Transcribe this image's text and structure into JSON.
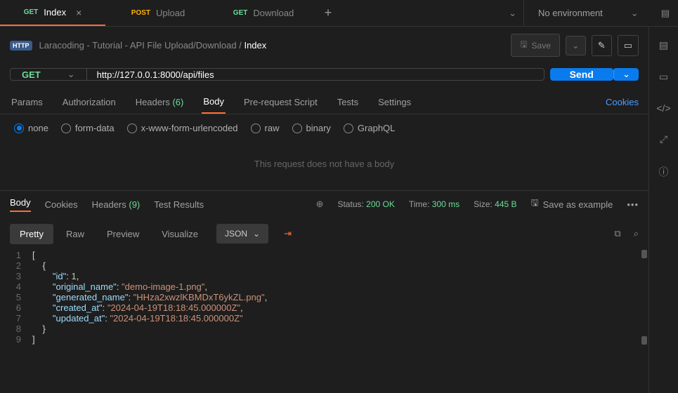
{
  "tabs": [
    {
      "method": "GET",
      "label": "Index",
      "active": true,
      "closable": true
    },
    {
      "method": "POST",
      "label": "Upload",
      "active": false,
      "closable": false
    },
    {
      "method": "GET",
      "label": "Download",
      "active": false,
      "closable": false
    }
  ],
  "environment": {
    "label": "No environment"
  },
  "breadcrumb": {
    "badge": "HTTP",
    "path": "Laracoding - Tutorial - API File Upload/Download",
    "sep": "/",
    "current": "Index"
  },
  "save_label": "Save",
  "request": {
    "method": "GET",
    "url": "http://127.0.0.1:8000/api/files"
  },
  "send_label": "Send",
  "req_tabs": {
    "params": "Params",
    "auth": "Authorization",
    "headers": "Headers",
    "headers_count": "(6)",
    "body": "Body",
    "presc": "Pre-request Script",
    "tests": "Tests",
    "settings": "Settings"
  },
  "cookies_link": "Cookies",
  "body_radios": {
    "none": "none",
    "formdata": "form-data",
    "xwww": "x-www-form-urlencoded",
    "raw": "raw",
    "binary": "binary",
    "graphql": "GraphQL"
  },
  "no_body_msg": "This request does not have a body",
  "resp_tabs": {
    "body": "Body",
    "cookies": "Cookies",
    "headers": "Headers",
    "headers_count": "(9)",
    "tests": "Test Results"
  },
  "resp_status": {
    "status_lbl": "Status:",
    "status_val": "200 OK",
    "time_lbl": "Time:",
    "time_val": "300 ms",
    "size_lbl": "Size:",
    "size_val": "445 B"
  },
  "save_example": "Save as example",
  "view_tabs": {
    "pretty": "Pretty",
    "raw": "Raw",
    "preview": "Preview",
    "visualize": "Visualize"
  },
  "format_sel": "JSON",
  "json_body": {
    "id": 1,
    "original_name": "demo-image-1.png",
    "generated_name": "HHza2xwzlKBMDxT6ykZL.png",
    "created_at": "2024-04-19T18:18:45.000000Z",
    "updated_at": "2024-04-19T18:18:45.000000Z"
  },
  "keys": {
    "id": "\"id\"",
    "orig": "\"original_name\"",
    "gen": "\"generated_name\"",
    "cre": "\"created_at\"",
    "upd": "\"updated_at\""
  },
  "vals": {
    "id": "1",
    "orig": "\"demo-image-1.png\"",
    "gen": "\"HHza2xwzlKBMDxT6ykZL.png\"",
    "cre": "\"2024-04-19T18:18:45.000000Z\"",
    "upd": "\"2024-04-19T18:18:45.000000Z\""
  }
}
